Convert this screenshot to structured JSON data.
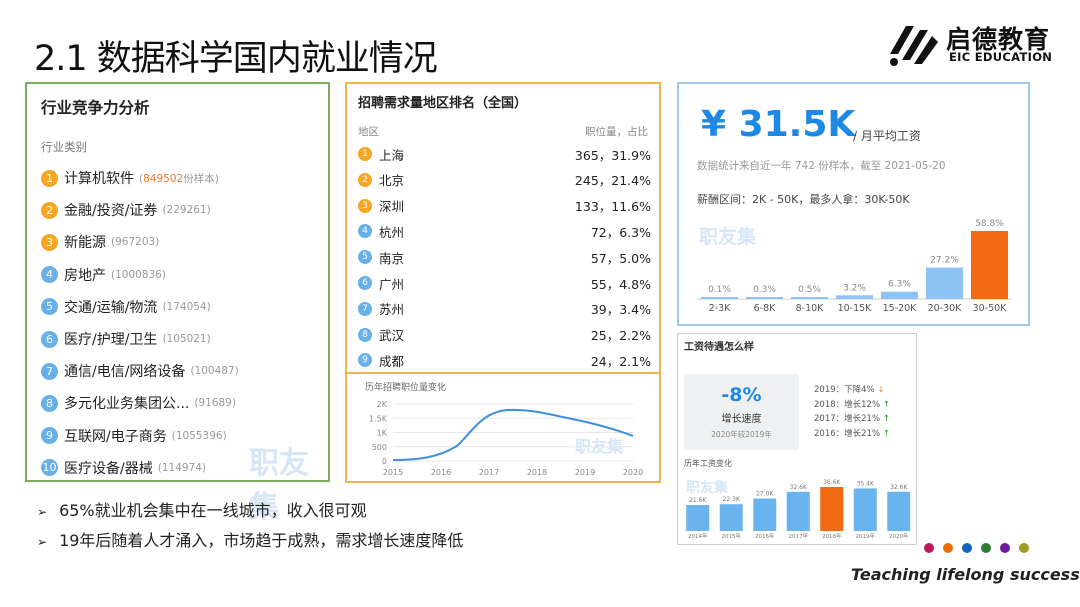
{
  "slide": {
    "title": "2.1 数据科学国内就业情况",
    "logo": {
      "cn": "启德教育",
      "en": "EIC EDUCATION"
    },
    "slogan": "Teaching lifelong success",
    "dot_colors": [
      "#c2185b",
      "#ef6c00",
      "#1565c0",
      "#2e7d32",
      "#6a1b9a",
      "#9e9d24"
    ]
  },
  "industry": {
    "title": "行业竞争力分析",
    "subtitle": "行业类别",
    "watermark": "职友集",
    "items": [
      {
        "rank": "1",
        "name": "计算机软件",
        "count": "849502",
        "count_suffix": "份样本)",
        "paren": "(",
        "highlight": true
      },
      {
        "rank": "2",
        "name": "金融/投资/证券",
        "count": "(229261)"
      },
      {
        "rank": "3",
        "name": "新能源",
        "count": "(967203)"
      },
      {
        "rank": "4",
        "name": "房地产",
        "count": "(1000836)"
      },
      {
        "rank": "5",
        "name": "交通/运输/物流",
        "count": "(174054)"
      },
      {
        "rank": "6",
        "name": "医疗/护理/卫生",
        "count": "(105021)"
      },
      {
        "rank": "7",
        "name": "通信/电信/网络设备",
        "count": "(100487)"
      },
      {
        "rank": "8",
        "name": "多元化业务集团公...",
        "count": "(91689)"
      },
      {
        "rank": "9",
        "name": "互联网/电子商务",
        "count": "(1055396)"
      },
      {
        "rank": "10",
        "name": "医疗设备/器械",
        "count": "(114974)"
      }
    ]
  },
  "regions": {
    "title": "招聘需求量地区排名（全国）",
    "col_region": "地区",
    "col_value": "职位量，占比",
    "rows": [
      {
        "rank": "1",
        "name": "上海",
        "value": "365，31.9%"
      },
      {
        "rank": "2",
        "name": "北京",
        "value": "245，21.4%"
      },
      {
        "rank": "3",
        "name": "深圳",
        "value": "133，11.6%"
      },
      {
        "rank": "4",
        "name": "杭州",
        "value": "72，6.3%"
      },
      {
        "rank": "5",
        "name": "南京",
        "value": "57，5.0%"
      },
      {
        "rank": "6",
        "name": "广州",
        "value": "55，4.8%"
      },
      {
        "rank": "7",
        "name": "苏州",
        "value": "39，3.4%"
      },
      {
        "rank": "8",
        "name": "武汉",
        "value": "25，2.2%"
      },
      {
        "rank": "9",
        "name": "成都",
        "value": "24，2.1%"
      }
    ]
  },
  "trend": {
    "title": "历年招聘职位量变化",
    "watermark": "职友集",
    "y_ticks": [
      "2K",
      "1.5K",
      "1K",
      "500",
      "0"
    ],
    "x_ticks": [
      "2015",
      "2016",
      "2017",
      "2018",
      "2019",
      "2020"
    ]
  },
  "salary": {
    "value": "¥ 31.5K",
    "label": "/ 月平均工资",
    "note": "数据统计来自近一年 742 份样本，截至 2021-05-20",
    "range": "薪酬区间：2K - 50K，最多人拿：30K-50K",
    "watermark": "职友集",
    "bars": [
      {
        "cat": "2-3K",
        "pct": "0.1%",
        "v": 0.1
      },
      {
        "cat": "6-8K",
        "pct": "0.3%",
        "v": 0.3
      },
      {
        "cat": "8-10K",
        "pct": "0.5%",
        "v": 0.5
      },
      {
        "cat": "10-15K",
        "pct": "3.2%",
        "v": 3.2
      },
      {
        "cat": "15-20K",
        "pct": "6.3%",
        "v": 6.3
      },
      {
        "cat": "20-30K",
        "pct": "27.2%",
        "v": 27.2
      },
      {
        "cat": "30-50K",
        "pct": "58.8%",
        "v": 58.8,
        "highlight": true
      }
    ]
  },
  "growth": {
    "title": "工资待遇怎么样",
    "value": "-8%",
    "label": "增长速度",
    "sub": "2020年较2019年",
    "history": [
      {
        "text": "2019：下降4%",
        "arrow": "↓",
        "dir": "down"
      },
      {
        "text": "2018：增长12%",
        "arrow": "↑",
        "dir": "up"
      },
      {
        "text": "2017：增长21%",
        "arrow": "↑",
        "dir": "up"
      },
      {
        "text": "2016：增长21%",
        "arrow": "↑",
        "dir": "up"
      }
    ],
    "chart_title": "历年工资变化",
    "watermark": "职友集",
    "bars": [
      {
        "year": "2014年",
        "label": "21.6K",
        "v": 21.6
      },
      {
        "year": "2015年",
        "label": "22.3K",
        "v": 22.3
      },
      {
        "year": "2016年",
        "label": "27.0K",
        "v": 27.0
      },
      {
        "year": "2017年",
        "label": "32.6K",
        "v": 32.6
      },
      {
        "year": "2018年",
        "label": "36.6K",
        "v": 36.6,
        "highlight": true
      },
      {
        "year": "2019年",
        "label": "35.4K",
        "v": 35.4
      },
      {
        "year": "2020年",
        "label": "32.6K",
        "v": 32.6
      }
    ]
  },
  "bullets": [
    "65%就业机会集中在一线城市，收入很可观",
    "19年后随着人才涌入，市场趋于成熟，需求增长速度降低"
  ],
  "bullet_marker": "➢",
  "colors": {
    "green_border": "#77ad5c",
    "orange_border": "#f0b44c",
    "blue": "#1e88e5",
    "bar_blue": "#69b3ef",
    "bar_orange": "#f26a12"
  }
}
